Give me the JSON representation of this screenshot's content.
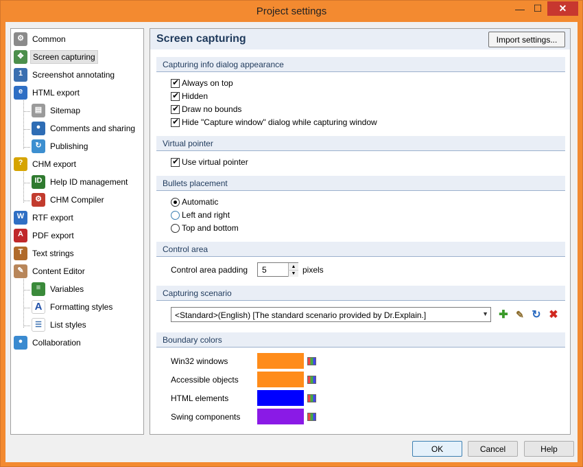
{
  "window": {
    "title": "Project settings",
    "minimize": "—",
    "maximize": "☐",
    "close": "✕"
  },
  "tree": [
    {
      "label": "Common",
      "icon": "gear-icon",
      "color": "#8a8a8a",
      "glyph": "⚙",
      "level": 0
    },
    {
      "label": "Screen capturing",
      "icon": "capture-icon",
      "color": "#4c8f4c",
      "glyph": "✥",
      "level": 0,
      "selected": true
    },
    {
      "label": "Screenshot annotating",
      "icon": "annotate-icon",
      "color": "#3a6fb0",
      "glyph": "1",
      "level": 0
    },
    {
      "label": "HTML export",
      "icon": "html-export-icon",
      "color": "#2f6fc4",
      "glyph": "e",
      "level": 0
    },
    {
      "label": "Sitemap",
      "icon": "sitemap-icon",
      "color": "#9a9a9a",
      "glyph": "▤",
      "level": 1
    },
    {
      "label": "Comments and sharing",
      "icon": "comments-icon",
      "color": "#2e6db5",
      "glyph": "●",
      "level": 1
    },
    {
      "label": "Publishing",
      "icon": "publishing-icon",
      "color": "#3d8fd0",
      "glyph": "↻",
      "level": 1
    },
    {
      "label": "CHM export",
      "icon": "chm-export-icon",
      "color": "#d6a400",
      "glyph": "?",
      "level": 0
    },
    {
      "label": "Help ID management",
      "icon": "help-id-icon",
      "color": "#2f7a2f",
      "glyph": "ID",
      "level": 1
    },
    {
      "label": "CHM Compiler",
      "icon": "chm-compiler-icon",
      "color": "#c23b2e",
      "glyph": "⚙",
      "level": 1
    },
    {
      "label": "RTF export",
      "icon": "rtf-export-icon",
      "color": "#2f6fc4",
      "glyph": "W",
      "level": 0
    },
    {
      "label": "PDF export",
      "icon": "pdf-export-icon",
      "color": "#c0282a",
      "glyph": "A",
      "level": 0
    },
    {
      "label": "Text strings",
      "icon": "text-strings-icon",
      "color": "#b06a2a",
      "glyph": "T",
      "level": 0
    },
    {
      "label": "Content Editor",
      "icon": "content-editor-icon",
      "color": "#b8865a",
      "glyph": "✎",
      "level": 0
    },
    {
      "label": "Variables",
      "icon": "variables-icon",
      "color": "#3a8a3a",
      "glyph": "≡",
      "level": 1
    },
    {
      "label": "Formatting styles",
      "icon": "formatting-styles-icon",
      "color": "#ffffff",
      "glyph": "A",
      "level": 1,
      "fg": "#1f4fa8"
    },
    {
      "label": "List styles",
      "icon": "list-styles-icon",
      "color": "#ffffff",
      "glyph": "☰",
      "level": 1,
      "fg": "#3a6fb0"
    },
    {
      "label": "Collaboration",
      "icon": "collaboration-icon",
      "color": "#3a8ad0",
      "glyph": "●",
      "level": 0
    }
  ],
  "panel": {
    "title": "Screen capturing",
    "import_label": "Import settings...",
    "sections": {
      "capturing_info": "Capturing info dialog appearance",
      "virtual_pointer": "Virtual pointer",
      "bullets": "Bullets placement",
      "control_area": "Control area",
      "scenario": "Capturing scenario",
      "boundary": "Boundary colors"
    },
    "capturing_options": [
      {
        "label": "Always on top",
        "checked": true
      },
      {
        "label": "Hidden",
        "checked": true
      },
      {
        "label": "Draw no bounds",
        "checked": true
      },
      {
        "label": "Hide \"Capture window\" dialog while capturing window",
        "checked": true
      }
    ],
    "virtual_pointer": {
      "label": "Use virtual pointer",
      "checked": true
    },
    "bullets": [
      {
        "label": "Automatic",
        "selected": true
      },
      {
        "label": "Left and right",
        "selected": false
      },
      {
        "label": "Top and bottom",
        "selected": false
      }
    ],
    "control_area": {
      "label": "Control area padding",
      "value": "5",
      "unit": "pixels"
    },
    "scenario": {
      "value": "<Standard>(English) [The standard scenario provided by Dr.Explain.]"
    },
    "boundary_colors": [
      {
        "label": "Win32 windows",
        "color": "#ff8c1a"
      },
      {
        "label": "Accessible objects",
        "color": "#ff8c1a"
      },
      {
        "label": "HTML elements",
        "color": "#0000ff"
      },
      {
        "label": "Swing components",
        "color": "#8a1ae6"
      }
    ]
  },
  "buttons": {
    "ok": "OK",
    "cancel": "Cancel",
    "help": "Help"
  }
}
